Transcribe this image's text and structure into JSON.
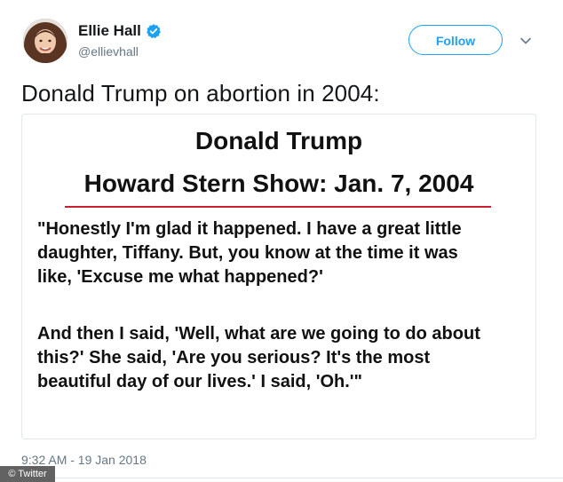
{
  "author": {
    "name": "Ellie Hall",
    "handle": "@ellievhall",
    "verified": true,
    "avatar_icon": "profile-photo"
  },
  "header": {
    "follow_label": "Follow",
    "menu_icon": "chevron-down-icon"
  },
  "tweet": {
    "text": "Donald Trump on abortion in 2004:",
    "timestamp": "9:32 AM - 19 Jan 2018"
  },
  "media": {
    "title": "Donald Trump",
    "subtitle": "Howard Stern Show: Jan. 7, 2004",
    "quote_paragraph_1": [
      "\"Honestly I'm glad it happened. I have a great little",
      "daughter, Tiffany. But, you know at the time it was",
      "like, 'Excuse me what happened?'"
    ],
    "quote_paragraph_2": [
      "And then I said, 'Well, what are we going to do about",
      "this?' She said, 'Are you serious? It's the most",
      "beautiful day of our lives.' I said, 'Oh.'\""
    ]
  },
  "watermark": "© Twitter",
  "colors": {
    "accent": "#1da1f2",
    "divider": "#c8202f",
    "muted_text": "#657786",
    "border": "#e1e8ed"
  }
}
